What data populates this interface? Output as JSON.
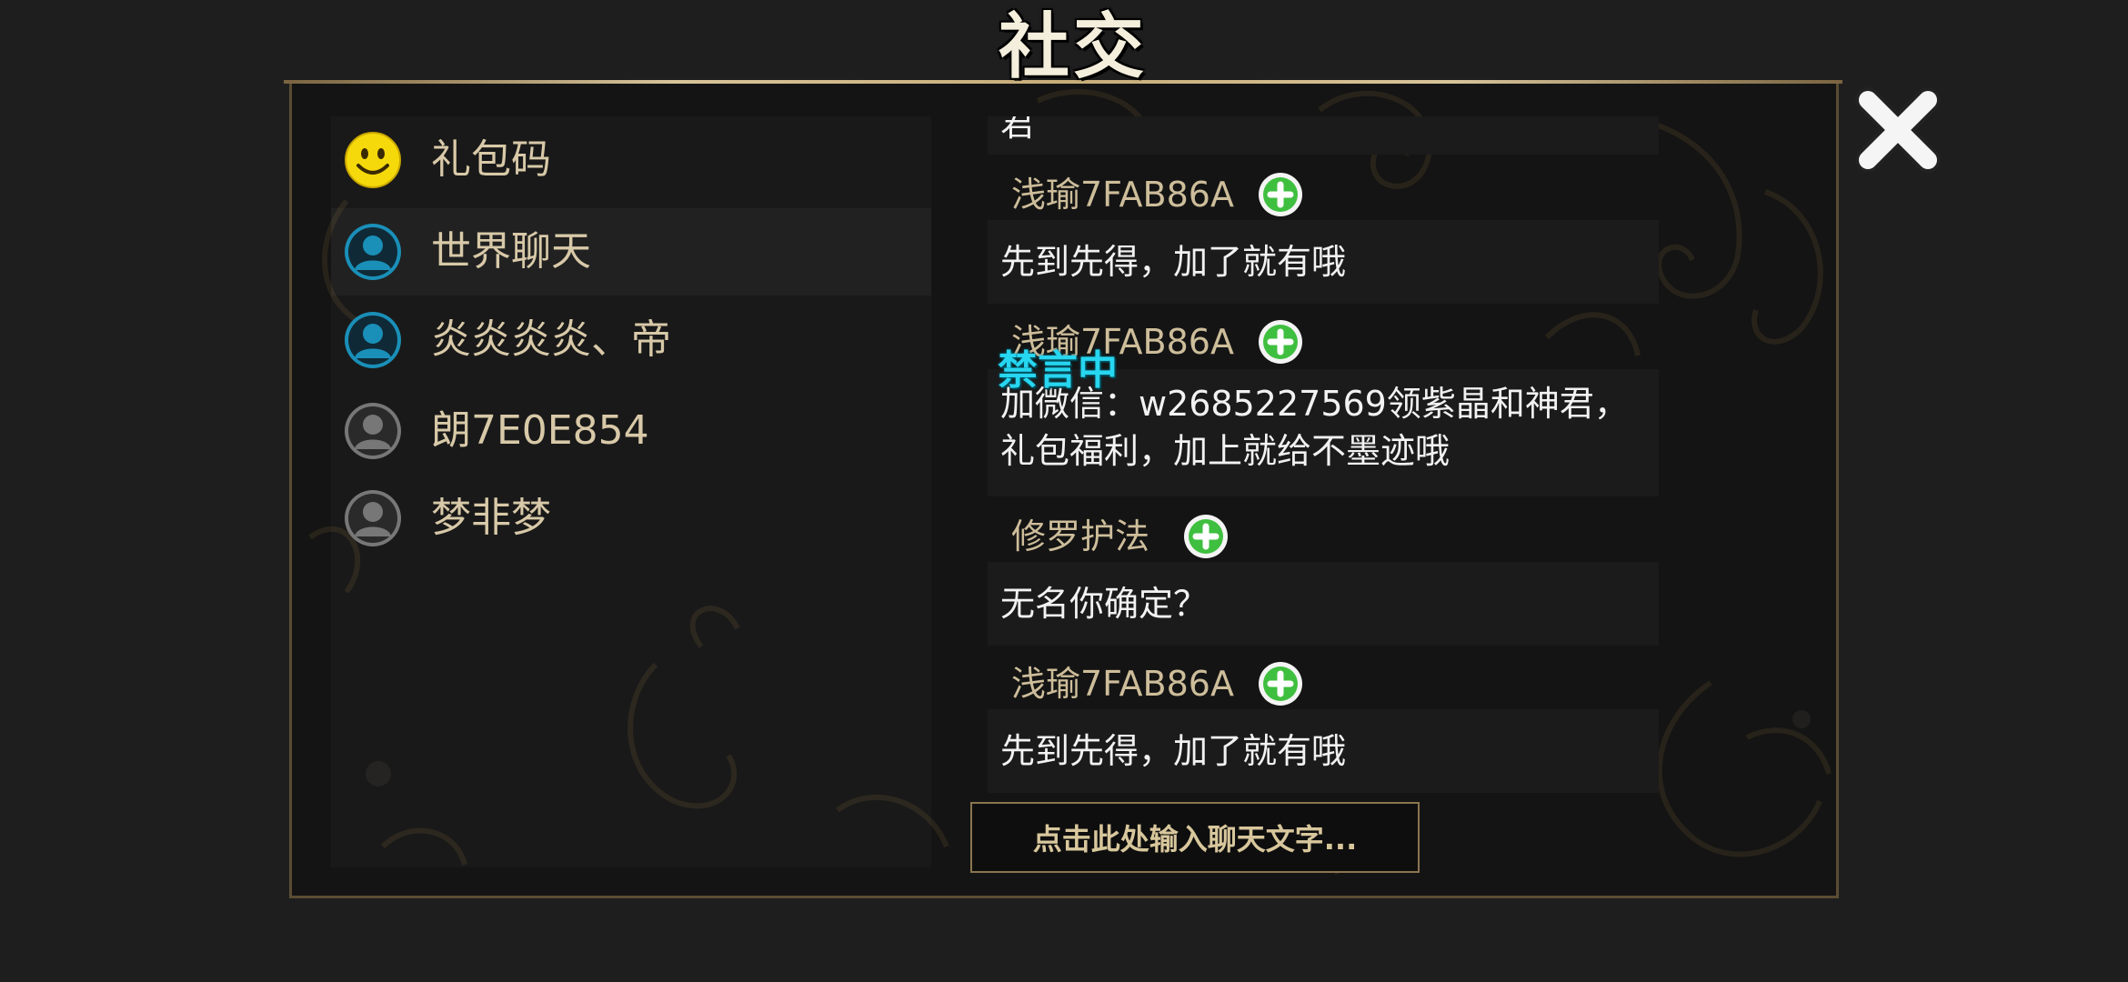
{
  "header": {
    "title": "社交"
  },
  "contacts": [
    {
      "label": "礼包码",
      "icon": "smiley-face-icon"
    },
    {
      "label": "世界聊天",
      "icon": "user-avatar-icon"
    },
    {
      "label": "炎炎炎炎、帝",
      "icon": "user-avatar-icon"
    },
    {
      "label": "朗7E0E854",
      "icon": "user-avatar-offline-icon"
    },
    {
      "label": "梦非梦",
      "icon": "user-avatar-offline-icon"
    }
  ],
  "messages": [
    {
      "text": "君",
      "partial": true
    },
    {
      "sender": "浅瑜7FAB86A",
      "lines": [
        "先到先得，加了就有哦"
      ]
    },
    {
      "sender": "浅瑜7FAB86A",
      "status_badge": "禁言中",
      "lines": [
        "加微信：w2685227569领紫晶和神君，",
        "礼包福利，加上就给不墨迹哦"
      ]
    },
    {
      "sender": "修罗护法",
      "lines": [
        "无名你确定？"
      ]
    },
    {
      "sender": "浅瑜7FAB86A",
      "lines": [
        "先到先得，加了就有哦"
      ]
    }
  ],
  "chat_input": {
    "placeholder": "点击此处输入聊天文字..."
  },
  "colors": {
    "background": "#1e1e1e",
    "panel": "#141414",
    "border_gold": "#8a7550",
    "text_gold": "#d8c9a8",
    "muted_badge": "#27d6f0",
    "add_green": "#3fbf3f",
    "avatar_blue": "#1a8fb8"
  }
}
